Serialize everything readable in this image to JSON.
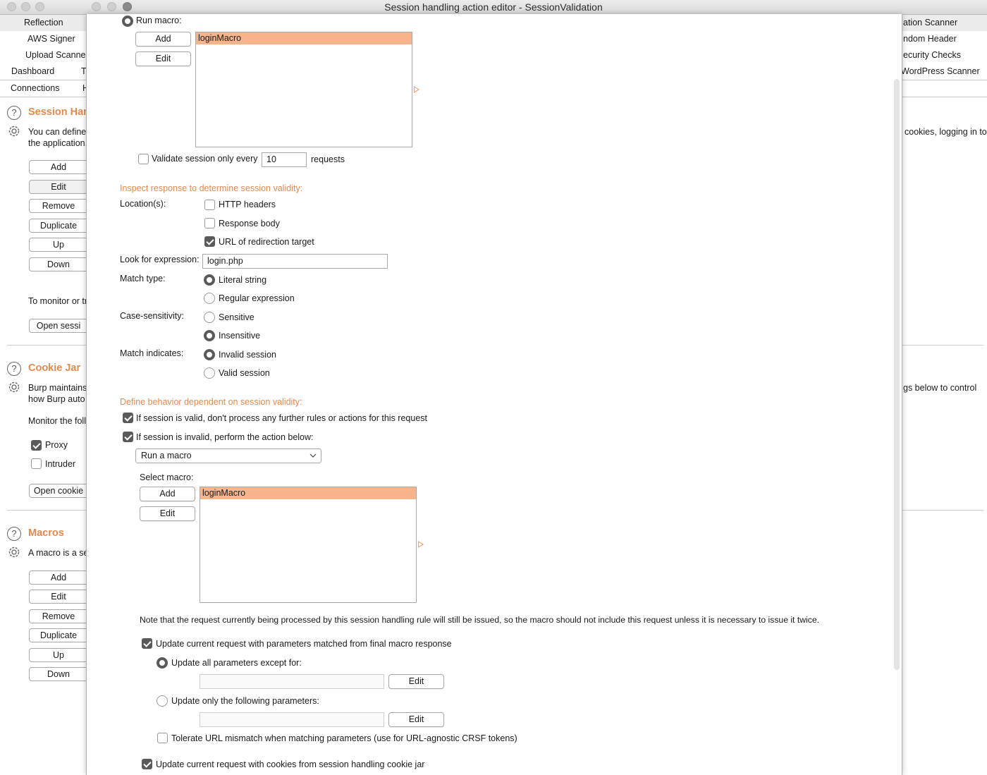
{
  "window": {
    "title": "Session handling action editor - SessionValidation"
  },
  "background": {
    "tabs_row1_left": "Reflection",
    "tabs_row2_left": "AWS Signer",
    "tabs_row3_left": "Upload Scanne",
    "tabs_row4_left": [
      "Dashboard",
      "T"
    ],
    "tabs_row5_left": [
      "Connections",
      "H"
    ],
    "tabs_right": [
      "ation Scanner",
      "ndom Header",
      "ecurity Checks",
      "WordPress Scanner"
    ],
    "session": {
      "title": "Session Han",
      "desc1": "You can define",
      "desc2": "the application,",
      "desc_right": "cookies, logging in to",
      "buttons": [
        "Add",
        "Edit",
        "Remove",
        "Duplicate",
        "Up",
        "Down"
      ],
      "monitor_text": "To monitor or tr",
      "open_button": "Open sessi"
    },
    "cookiejar": {
      "title": "Cookie Jar",
      "desc1": "Burp maintains",
      "desc2": "how Burp auto",
      "desc_right": "gs below to control",
      "monitor_text": "Monitor the follo",
      "proxy_label": "Proxy",
      "intruder_label": "Intruder",
      "open_button": "Open cookie"
    },
    "macros": {
      "title": "Macros",
      "desc1": "A macro is a se",
      "buttons": [
        "Add",
        "Edit",
        "Remove",
        "Duplicate",
        "Up",
        "Down"
      ]
    }
  },
  "dialog": {
    "run_macro_label": "Run macro:",
    "top_add": "Add",
    "top_edit": "Edit",
    "top_macro_selected": "loginMacro",
    "validate_label": "Validate session only every",
    "validate_value": "10",
    "requests_label": "requests",
    "inspect_section": "Inspect response to determine session validity:",
    "locations_label": "Location(s):",
    "loc_http_headers": "HTTP headers",
    "loc_response_body": "Response body",
    "loc_url_redirect": "URL of redirection target",
    "look_for_label": "Look for expression:",
    "look_for_value": "login.php",
    "match_type_label": "Match type:",
    "match_literal": "Literal string",
    "match_regex": "Regular expression",
    "case_label": "Case-sensitivity:",
    "case_sensitive": "Sensitive",
    "case_insensitive": "Insensitive",
    "match_indicates_label": "Match indicates:",
    "invalid_session": "Invalid session",
    "valid_session": "Valid session",
    "define_section": "Define behavior dependent on session validity:",
    "if_valid_label": "If session is valid, don't process any further rules or actions for this request",
    "if_invalid_label": "If session is invalid, perform the action below:",
    "action_select": "Run a macro",
    "select_macro_label": "Select macro:",
    "bottom_add": "Add",
    "bottom_edit": "Edit",
    "bottom_macro_selected": "loginMacro",
    "note": "Note that the request currently being processed by this session handling rule will still be issued, so the macro should not include this request unless it is necessary to issue it twice.",
    "update_params_label": "Update current request with parameters matched from final macro response",
    "update_all_label": "Update all parameters except for:",
    "edit_label_1": "Edit",
    "update_only_label": "Update only the following parameters:",
    "edit_label_2": "Edit",
    "tolerate_label": "Tolerate URL mismatch when matching parameters (use for URL-agnostic CRSF tokens)",
    "update_cookies_label": "Update current request with cookies from session handling cookie jar"
  },
  "colors": {
    "accent": "#e08a50",
    "selection": "#f8b48b"
  }
}
